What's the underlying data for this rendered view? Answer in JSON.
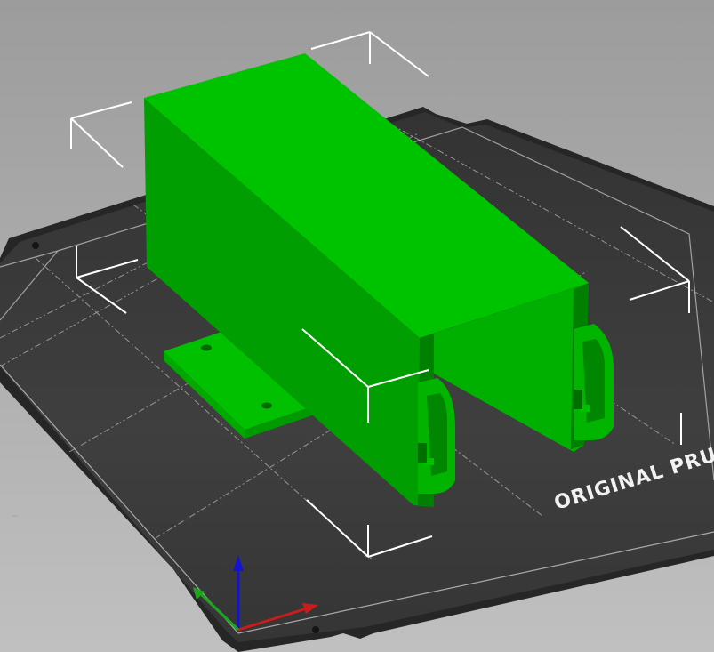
{
  "viewport": {
    "bed_label": "ORIGINAL PRUSA",
    "colors": {
      "background_top": "#9c9c9c",
      "background_bottom": "#c2c2c2",
      "bed_surface": "#3a3a3a",
      "bed_edge": "#262626",
      "grid_line": "#9a9a9a",
      "model_top": "#00c800",
      "model_front": "#00a600",
      "model_side": "#008f00",
      "bbox_corner": "#ffffff",
      "axis_x": "#cc1b1b",
      "axis_y": "#1ea41e",
      "axis_z": "#1313d0"
    },
    "axes": [
      "x-axis",
      "y-axis",
      "z-axis"
    ]
  }
}
